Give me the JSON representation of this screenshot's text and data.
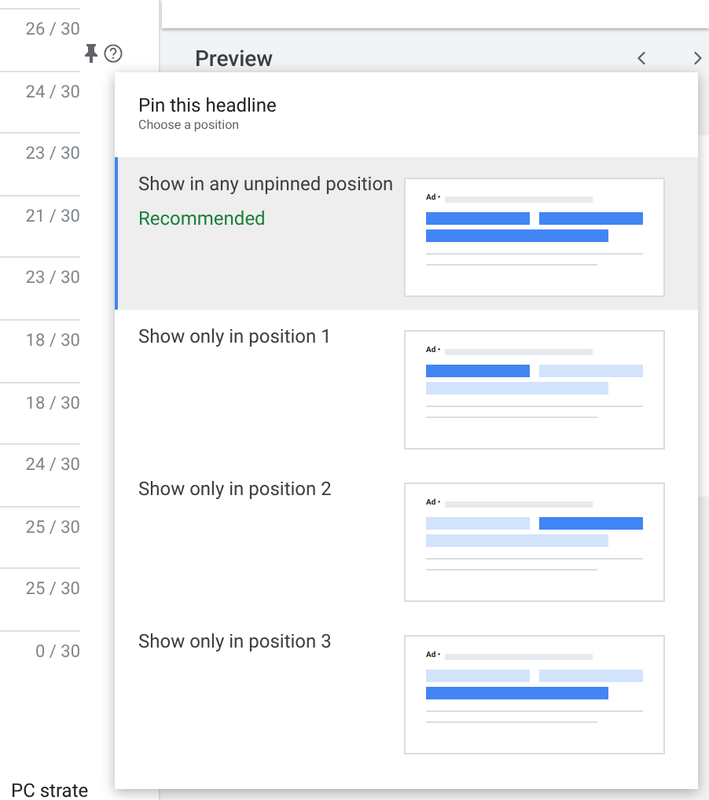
{
  "counters": [
    "26 / 30",
    "24 / 30",
    "23 / 30",
    "21 / 30",
    "23 / 30",
    "18 / 30",
    "18 / 30",
    "24 / 30",
    "25 / 30",
    "25 / 30",
    "0 / 30"
  ],
  "bottom_left_text": "PC strate",
  "preview": {
    "title": "Preview"
  },
  "popup": {
    "title": "Pin this headline",
    "subtitle": "Choose a position",
    "options": [
      {
        "label": "Show in any unpinned position",
        "note": "Recommended",
        "selected": true,
        "ad_label": "Ad •",
        "headlines": [
          {
            "on": true
          },
          {
            "on": true
          },
          {
            "on": true
          }
        ]
      },
      {
        "label": "Show only in position 1",
        "selected": false,
        "ad_label": "Ad •",
        "headlines": [
          {
            "on": true
          },
          {
            "on": false
          },
          {
            "on": false
          }
        ]
      },
      {
        "label": "Show only in position 2",
        "selected": false,
        "ad_label": "Ad •",
        "headlines": [
          {
            "on": false
          },
          {
            "on": true
          },
          {
            "on": false
          }
        ]
      },
      {
        "label": "Show only in position 3",
        "selected": false,
        "ad_label": "Ad •",
        "headlines": [
          {
            "on": false
          },
          {
            "on": false
          },
          {
            "on": true
          }
        ]
      }
    ]
  }
}
